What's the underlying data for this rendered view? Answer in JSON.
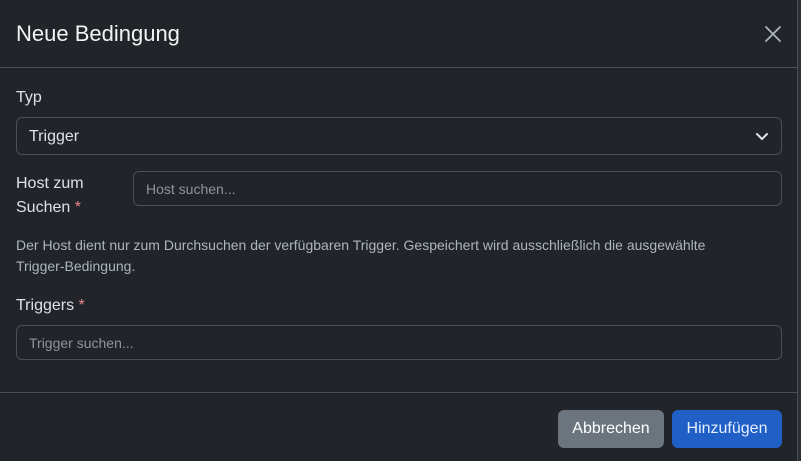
{
  "dialog": {
    "title": "Neue Bedingung",
    "close_icon": "close-icon"
  },
  "type_field": {
    "label": "Typ",
    "selected": "Trigger",
    "chevron_icon": "chevron-down-icon"
  },
  "host_field": {
    "label_line1": "Host zum",
    "label_line2": "Suchen",
    "required_mark": "*",
    "placeholder": "Host suchen..."
  },
  "help_text": "Der Host dient nur zum Durchsuchen der verfügbaren Trigger. Gespeichert wird ausschließlich die ausgewählte Trigger-Bedingung.",
  "triggers_field": {
    "label": "Triggers",
    "required_mark": "*",
    "placeholder": "Trigger suchen..."
  },
  "footer": {
    "cancel_label": "Abbrechen",
    "add_label": "Hinzufügen"
  },
  "colors": {
    "background": "#212529",
    "border": "#495057",
    "required": "#ea868f",
    "cancel_button": "#6c757d",
    "primary_button": "#1f5fc6"
  }
}
